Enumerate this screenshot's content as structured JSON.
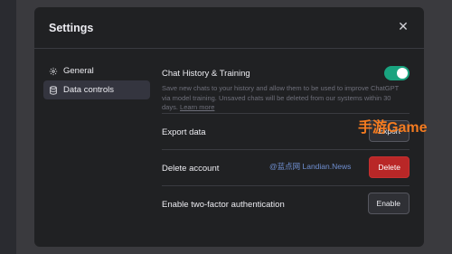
{
  "modal": {
    "title": "Settings"
  },
  "sidebar": {
    "items": [
      {
        "label": "General",
        "icon": "gear-icon",
        "active": false
      },
      {
        "label": "Data controls",
        "icon": "database-icon",
        "active": true
      }
    ]
  },
  "settings": {
    "history": {
      "label": "Chat History & Training",
      "enabled": true,
      "description": "Save new chats to your history and allow them to be used to improve ChatGPT via model training. Unsaved chats will be deleted from our systems within 30 days.",
      "learn_more": "Learn more"
    },
    "export": {
      "label": "Export data",
      "button": "Export"
    },
    "delete": {
      "label": "Delete account",
      "button": "Delete"
    },
    "two_factor": {
      "label": "Enable two-factor authentication",
      "button": "Enable"
    }
  },
  "watermarks": {
    "site": "@蓝点网 Landian.News",
    "game": "手游Game"
  },
  "colors": {
    "toggle_on": "#19a37f",
    "danger": "#b92727"
  }
}
